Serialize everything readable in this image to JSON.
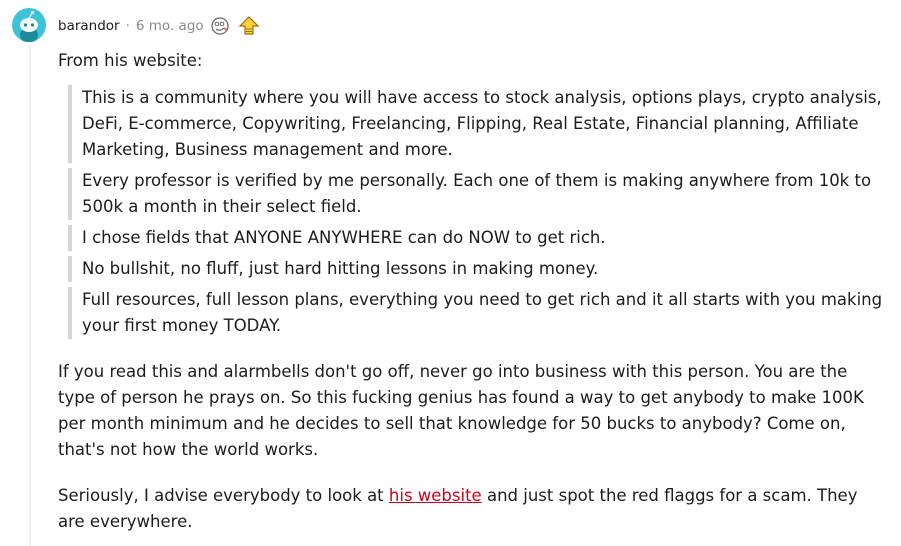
{
  "comment": {
    "username": "barandor",
    "separator": "·",
    "timestamp": "6 mo. ago",
    "intro": "From his website:",
    "quotes": [
      "This is a community where you will have access to stock analysis, options plays, crypto analysis, DeFi, E-commerce, Copywriting, Freelancing, Flipping, Real Estate, Financial planning, Affiliate Marketing, Business management and more.",
      "Every professor is verified by me personally. Each one of them is making anywhere from 10k to 500k a month in their select field.",
      "I chose fields that ANYONE ANYWHERE can do NOW to get rich.",
      "No bullshit, no fluff, just hard hitting lessons in making money.",
      "Full resources, full lesson plans, everything you need to get rich and it all starts with you making your first money TODAY."
    ],
    "paragraph1": "If you read this and alarmbells don't go off, never go into business with this person. You are the type of person he prays on. So this fucking genius has found a way to get anybody to make 100K per month minimum and he decides to sell that knowledge for 50 bucks to anybody? Come on, that's not how the world works.",
    "paragraph2_before": "Seriously, I advise everybody to look at ",
    "paragraph2_link": "his website",
    "paragraph2_after": " and just spot the red flaggs for a scam. They are everywhere."
  },
  "icons": {
    "avatar": "snoo-avatar",
    "award1": "silly-face-award-icon",
    "award2": "upvote-arrow-award-icon"
  },
  "colors": {
    "avatar_bg": "#3ec3d6",
    "link": "#d0021b",
    "quote_border": "#d4d6d8",
    "meta_text": "#878a8c"
  }
}
